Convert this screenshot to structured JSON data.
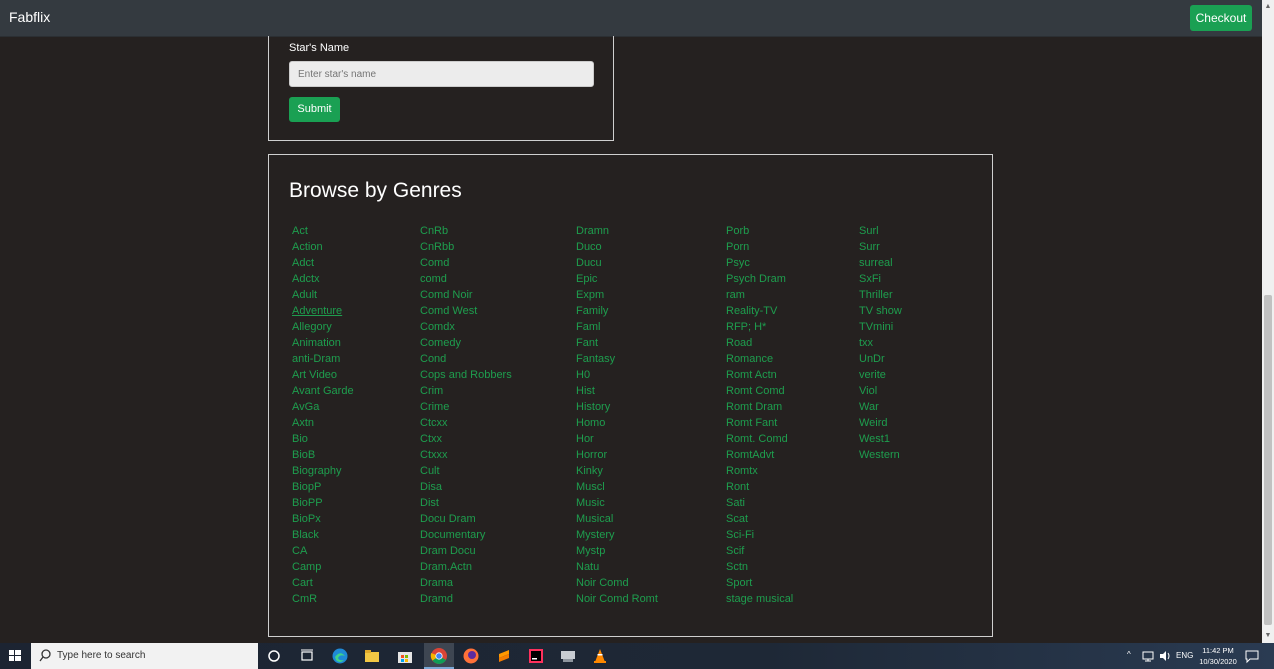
{
  "navbar": {
    "brand": "Fabflix",
    "checkout_label": "Checkout"
  },
  "star_search": {
    "label": "Star's Name",
    "input_placeholder": "Enter star's name",
    "input_value": "",
    "submit_label": "Submit"
  },
  "genres": {
    "title": "Browse by Genres",
    "columns": [
      [
        "Act",
        "Action",
        "Adct",
        "Adctx",
        "Adult",
        "Adventure",
        "Allegory",
        "Animation",
        "anti-Dram",
        "Art Video",
        "Avant Garde",
        "AvGa",
        "Axtn",
        "Bio",
        "BioB",
        "Biography",
        "BiopP",
        "BioPP",
        "BioPx",
        "Black",
        "CA",
        "Camp",
        "Cart",
        "CmR"
      ],
      [
        "CnRb",
        "CnRbb",
        "Comd",
        "comd",
        "Comd Noir",
        "Comd West",
        "Comdx",
        "Comedy",
        "Cond",
        "Cops and Robbers",
        "Crim",
        "Crime",
        "Ctcxx",
        "Ctxx",
        "Ctxxx",
        "Cult",
        "Disa",
        "Dist",
        "Docu Dram",
        "Documentary",
        "Dram Docu",
        "Dram.Actn",
        "Drama",
        "Dramd"
      ],
      [
        "Dramn",
        "Duco",
        "Ducu",
        "Epic",
        "Expm",
        "Family",
        "Faml",
        "Fant",
        "Fantasy",
        "H0",
        "Hist",
        "History",
        "Homo",
        "Hor",
        "Horror",
        "Kinky",
        "Muscl",
        "Music",
        "Musical",
        "Mystery",
        "Mystp",
        "Natu",
        "Noir Comd",
        "Noir Comd Romt"
      ],
      [
        "Porb",
        "Porn",
        "Psyc",
        "Psych Dram",
        "ram",
        "Reality-TV",
        "RFP; H*",
        "Road",
        "Romance",
        "Romt Actn",
        "Romt Comd",
        "Romt Dram",
        "Romt Fant",
        "Romt. Comd",
        "RomtAdvt",
        "Romtx",
        "Ront",
        "Sati",
        "Scat",
        "Sci-Fi",
        "Scif",
        "Sctn",
        "Sport",
        "stage musical"
      ],
      [
        "Surl",
        "Surr",
        "surreal",
        "SxFi",
        "Thriller",
        "TV show",
        "TVmini",
        "txx",
        "UnDr",
        "verite",
        "Viol",
        "War",
        "Weird",
        "West1",
        "Western"
      ]
    ],
    "hovered": "Adventure"
  },
  "taskbar": {
    "search_placeholder": "Type here to search",
    "language": "ENG",
    "time": "11:42 PM",
    "date": "10/30/2020",
    "pinned_icons": [
      "task-view-icon",
      "edge-icon",
      "file-explorer-icon",
      "store-icon",
      "chrome-icon",
      "firefox-icon",
      "sublime-icon",
      "intellij-icon",
      "network-drive-icon",
      "vlc-icon"
    ]
  },
  "colors": {
    "background": "#252120",
    "navbar": "#343a40",
    "accent": "#1aa053",
    "link": "#1e9e4e"
  }
}
